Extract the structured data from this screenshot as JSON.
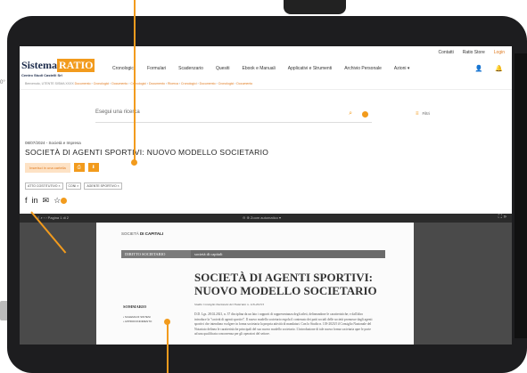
{
  "topbar": {
    "contatti": "Contatti",
    "store": "Ratio Store",
    "login": "Login"
  },
  "logo": {
    "brand": "Sistema",
    "ratio": "RATIO",
    "sub": "Centro Studi Castelli Srl"
  },
  "nav": [
    "Cronologici",
    "Formulari",
    "Scadenzario",
    "Quesiti",
    "Ebook e Manuali",
    "Applicativi e Strumenti",
    "Archivio Personale",
    "Azioni ▾"
  ],
  "breadcrumb": {
    "prefix": "Benvenuto, UTENTE SISMA XXXX",
    "links": [
      "Documento",
      "Cronologici",
      "Documento",
      "Cronologici",
      "Documento",
      "Ricerca",
      "Cronologici",
      "Documento",
      "Cronologici",
      "Documento"
    ]
  },
  "search": {
    "placeholder": "Esegui una ricerca",
    "filters": "Filtri"
  },
  "doc": {
    "meta": "08/07/2024 - Società e Impresa",
    "title": "SOCIETÀ DI AGENTI SPORTIVI: NUOVO MODELLO SOCIETARIO",
    "add_folder": "Inserisci in una cartella",
    "btn1": "⎙",
    "btn2": "⬇",
    "tags": [
      "ATTO COSTITUTIVO ×",
      "CONI ×",
      "AGENTE SPORTIVO ×"
    ]
  },
  "share": {
    "fb": "f",
    "li": "in",
    "mail": "✉",
    "star": "☆"
  },
  "pdfbar": {
    "left": "≡  ⌕  ‹  ›  Pagina  1 di 2",
    "zoom": "⊖  ⊕  Zoom automatico  ▾",
    "right": "⛶  »"
  },
  "pdf": {
    "section_pre": "SOCIETÀ ",
    "section_bold": "DI CAPITALI",
    "bar1": "DIRITTO SOCIETARIO",
    "bar2": "società di capitali",
    "title": "SOCIETÀ DI AGENTI SPORTIVI: NUOVO MODELLO SOCIETARIO",
    "studio": "Studio Consiglio Nazionale del Notariato n. 118-2023/I",
    "body": "D.D. Lgs. 28.02.2021, n. 37 disciplina da un lato i rapporti di rappresentanza degli atleti, delineandone le caratteristiche; e dall'altro introduce la \"società di agenti sportivi\". Il nuovo modello societario regola il contenuto dei patti sociali delle società promosse dagli agenti sportivi che intendono svolgere in forma societaria la propria attività di mandatari. Con lo Studio n. 118-2023/I il Consiglio Nazionale del Notariato delinea le caratteristiche principali del suo nuovo modello societario. L'introduzione di tale nuova forma societaria apre le porte ad una qualificata concorrenza per gli operatori del settore.",
    "sommario": "SOMMARIO",
    "som_items": [
      "• SCHEMA DI SINTESI",
      "• APPROFONDIMENTO"
    ]
  },
  "colors": {
    "accent": "#f29b1d",
    "navy": "#1b2a4a",
    "bezel": "#1d1d1f"
  },
  "icons": {
    "user": "user-icon",
    "bell": "bell-icon",
    "search": "search-icon"
  },
  "stub": "0°"
}
